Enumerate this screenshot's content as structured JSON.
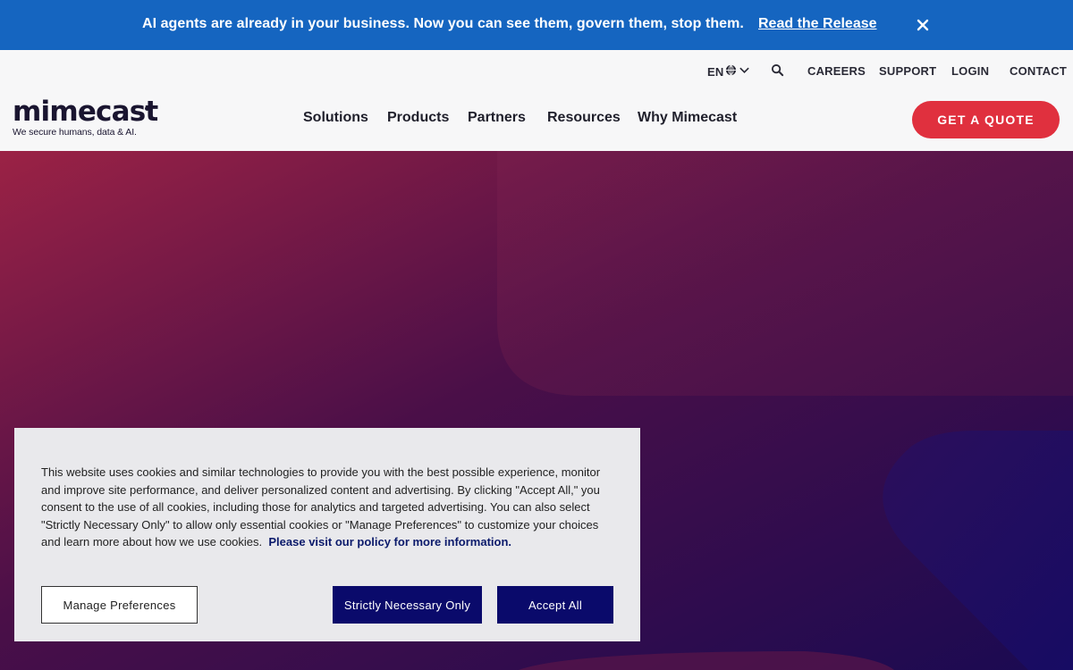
{
  "announcement": {
    "text": "AI agents are already in your business. Now you can see them, govern them, stop them.",
    "link_label": "Read the Release",
    "close_icon": "close-icon"
  },
  "utility_nav": {
    "language": "EN",
    "language_icons": [
      "globe-icon",
      "chevron-down-icon"
    ],
    "search_icon": "search-icon",
    "careers": "CAREERS",
    "support": "SUPPORT",
    "login": "LOGIN",
    "contact": "CONTACT"
  },
  "logo": {
    "wordmark": "mimecast",
    "tagline": "We secure humans, data & AI."
  },
  "main_nav": {
    "items": [
      "Solutions",
      "Products",
      "Partners",
      "Resources",
      "Why Mimecast"
    ]
  },
  "cta": {
    "quote_label": "GET A QUOTE"
  },
  "cookie_banner": {
    "text": "This website uses cookies and similar technologies to provide you with the best possible experience, monitor and improve site performance, and deliver personalized content and advertising. By clicking \"Accept All,\" you consent to the use of all cookies, including those for analytics and targeted advertising. You can also select \"Strictly Necessary Only\" to allow only essential cookies or \"Manage Preferences\" to customize your choices and learn more about how we use cookies.",
    "link_text": "Please visit our policy for more information.",
    "manage_label": "Manage Preferences",
    "strict_label": "Strictly Necessary Only",
    "accept_label": "Accept All"
  },
  "colors": {
    "announcement_bg": "#1565c0",
    "header_bg": "#f7f7f8",
    "cta_red": "#e0303e",
    "hero_start": "#9b2245",
    "hero_end": "#1a0a52",
    "button_navy": "#0a0a6b"
  }
}
